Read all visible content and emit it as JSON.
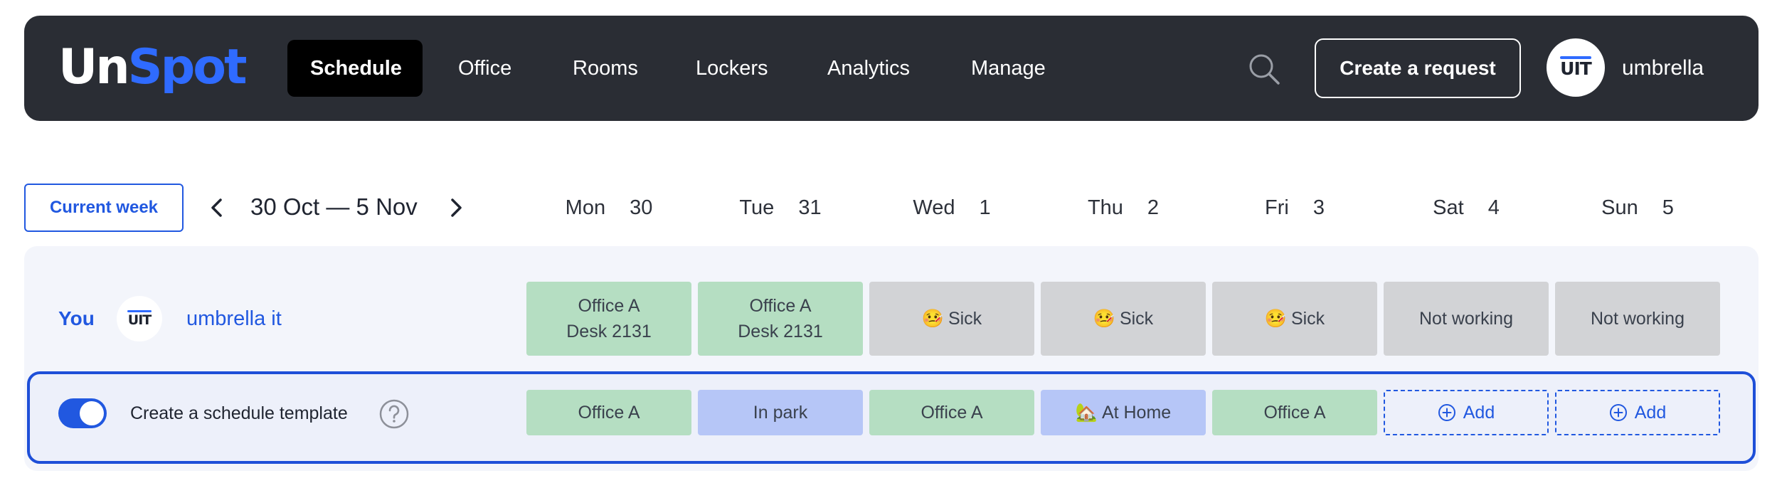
{
  "header": {
    "logo": {
      "part1": "Un",
      "part2": "Spot"
    },
    "nav": [
      "Schedule",
      "Office",
      "Rooms",
      "Lockers",
      "Analytics",
      "Manage"
    ],
    "create_request": "Create a request",
    "avatar_text": "UIT",
    "username": "umbrella"
  },
  "week": {
    "current_week": "Current week",
    "range": "30 Oct — 5 Nov",
    "days": [
      {
        "name": "Mon",
        "num": "30"
      },
      {
        "name": "Tue",
        "num": "31"
      },
      {
        "name": "Wed",
        "num": "1"
      },
      {
        "name": "Thu",
        "num": "2"
      },
      {
        "name": "Fri",
        "num": "3"
      },
      {
        "name": "Sat",
        "num": "4"
      },
      {
        "name": "Sun",
        "num": "5"
      }
    ]
  },
  "you": {
    "label": "You",
    "avatar_text": "UIT",
    "name": "umbrella it",
    "cells": [
      {
        "line1": "Office A",
        "line2": "Desk 2131"
      },
      {
        "line1": "Office A",
        "line2": "Desk 2131"
      },
      {
        "glyph": "🤒",
        "text": "Sick"
      },
      {
        "glyph": "🤒",
        "text": "Sick"
      },
      {
        "glyph": "🤒",
        "text": "Sick"
      },
      {
        "text": "Not working"
      },
      {
        "text": "Not working"
      }
    ]
  },
  "template": {
    "label": "Create a schedule template",
    "toggle_on": true,
    "cells": [
      {
        "text": "Office A"
      },
      {
        "text": "In park"
      },
      {
        "text": "Office A"
      },
      {
        "glyph": "🏡",
        "text": "At Home"
      },
      {
        "text": "Office A"
      },
      {
        "text": "Add"
      },
      {
        "text": "Add"
      }
    ]
  },
  "colors": {
    "accent": "#2158e0",
    "office": "#b5dec2",
    "absent": "#d2d3d6",
    "park": "#b6c6f7",
    "header_bg": "#2a2d34"
  },
  "icons": [
    "search-icon",
    "chevron-left-icon",
    "chevron-right-icon",
    "help-icon",
    "plus-circle-icon"
  ]
}
